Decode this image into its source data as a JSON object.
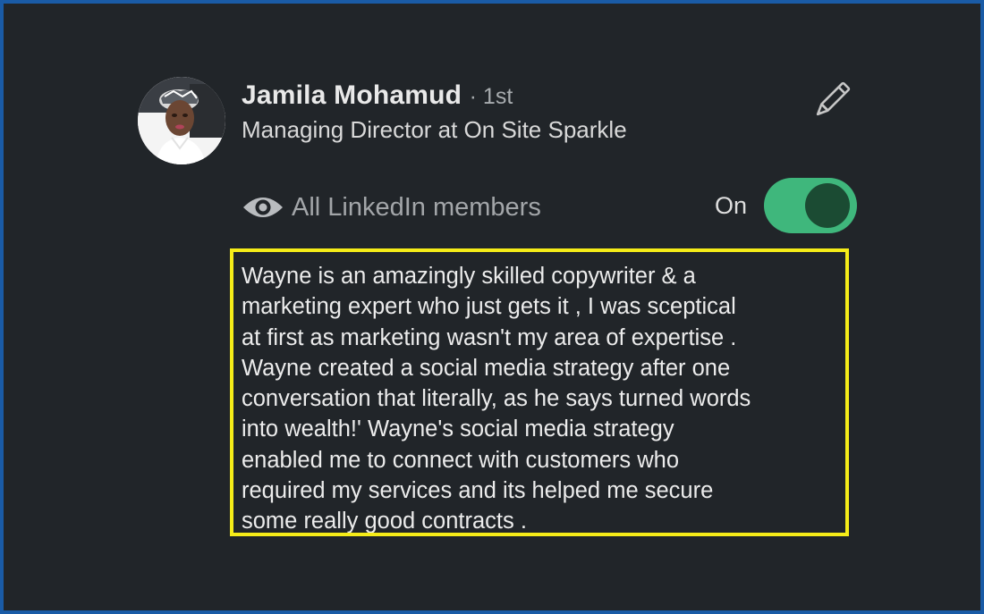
{
  "profile": {
    "name": "Jamila Mohamud",
    "degree": "· 1st",
    "headline": "Managing Director at On Site Sparkle",
    "avatar_icon": "profile-photo",
    "edit_icon": "pencil-icon"
  },
  "visibility": {
    "icon": "eye-icon",
    "label": "All LinkedIn members",
    "toggle_label": "On",
    "toggle_on": true
  },
  "recommendation": {
    "text": "Wayne is an amazingly skilled copywriter & a\nmarketing expert  who just gets it ,  I was sceptical\nat first as marketing wasn't my area of expertise .\nWayne created a social media strategy after one\nconversation that literally, as he says turned words\ninto wealth!'  Wayne's social media strategy\nenabled me to connect with customers who\nrequired my services and its helped me secure\nsome really good contracts ."
  },
  "colors": {
    "background": "#212529",
    "frame_border": "#1a5ba6",
    "highlight_border": "#f5ec18",
    "toggle_on": "#3fb77c",
    "toggle_knob": "#1b4b33"
  }
}
